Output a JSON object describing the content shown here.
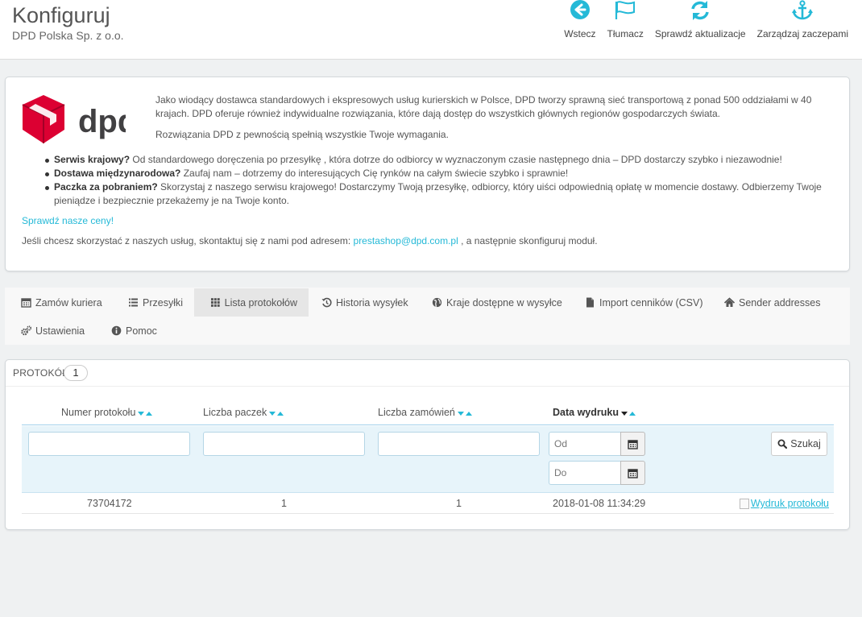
{
  "header": {
    "title": "Konfiguruj",
    "subtitle": "DPD Polska Sp. z o.o.",
    "toolbar": [
      {
        "label": "Wstecz",
        "icon": "back-circle-icon"
      },
      {
        "label": "Tłumacz",
        "icon": "flag-icon"
      },
      {
        "label": "Sprawdź aktualizacje",
        "icon": "refresh-icon"
      },
      {
        "label": "Zarządzaj zaczepami",
        "icon": "anchor-icon"
      }
    ]
  },
  "intro": {
    "logo_text": "dpd",
    "paragraph1": "Jako wiodący dostawca standardowych i ekspresowych usług kurierskich w Polsce, DPD tworzy sprawną sieć transportową z ponad 500 oddziałami w 40 krajach. DPD oferuje również indywidualne rozwiązania, które dają dostęp do wszystkich głównych regionów gospodarczych świata.",
    "paragraph2": "Rozwiązania DPD z pewnością spełnią wszystkie Twoje wymagania.",
    "bullets": [
      {
        "bold": "Serwis krajowy?",
        "text": " Od standardowego doręczenia po przesyłkę , która dotrze do odbiorcy w wyznaczonym czasie następnego dnia – DPD dostarczy szybko i niezawodnie!"
      },
      {
        "bold": "Dostawa międzynarodowa?",
        "text": " Zaufaj nam – dotrzemy do interesujących Cię rynków na całym świecie szybko i sprawnie!"
      },
      {
        "bold": "Paczka za pobraniem?",
        "text": " Skorzystaj z naszego serwisu krajowego! Dostarczymy Twoją przesyłkę, odbiorcy, który uiści odpowiednią opłatę w momencie dostawy. Odbierzemy Twoje pieniądze i bezpiecznie przekażemy je na Twoje konto."
      }
    ],
    "prices_link": "Sprawdź nasze ceny!",
    "contact_before": "Jeśli chcesz skorzystać z naszych usług, skontaktuj się z nami pod adresem: ",
    "contact_email": "prestashop@dpd.com.pl",
    "contact_after": " , a następnie skonfiguruj moduł."
  },
  "tabs": [
    {
      "label": "Zamów kuriera",
      "icon": "calendar-icon",
      "active": false
    },
    {
      "label": "Przesyłki",
      "icon": "list-icon",
      "active": false
    },
    {
      "label": "Lista protokołów",
      "icon": "grid-icon",
      "active": true
    },
    {
      "label": "Historia wysyłek",
      "icon": "history-icon",
      "active": false
    },
    {
      "label": "Kraje dostępne w wysyłce",
      "icon": "globe-icon",
      "active": false
    },
    {
      "label": "Import cenników (CSV)",
      "icon": "file-icon",
      "active": false
    },
    {
      "label": "Sender addresses",
      "icon": "home-icon",
      "active": false
    },
    {
      "label": "Ustawienia",
      "icon": "cogs-icon",
      "active": false
    },
    {
      "label": "Pomoc",
      "icon": "info-icon",
      "active": false
    }
  ],
  "protocols": {
    "title": "PROTOKÓŁ",
    "count": "1",
    "columns": [
      "Numer protokołu",
      "Liczba paczek",
      "Liczba zamówień",
      "Data wydruku"
    ],
    "filters": {
      "date_from_placeholder": "Od",
      "date_to_placeholder": "Do",
      "search_label": "Szukaj"
    },
    "rows": [
      {
        "number": "73704172",
        "packages": "1",
        "orders": "1",
        "date": "2018-01-08 11:34:29",
        "print_link": "Wydruk protokołu"
      }
    ]
  },
  "colors": {
    "accent": "#25b9d7",
    "dpd_red": "#dc0032",
    "dpd_gray": "#414042"
  }
}
